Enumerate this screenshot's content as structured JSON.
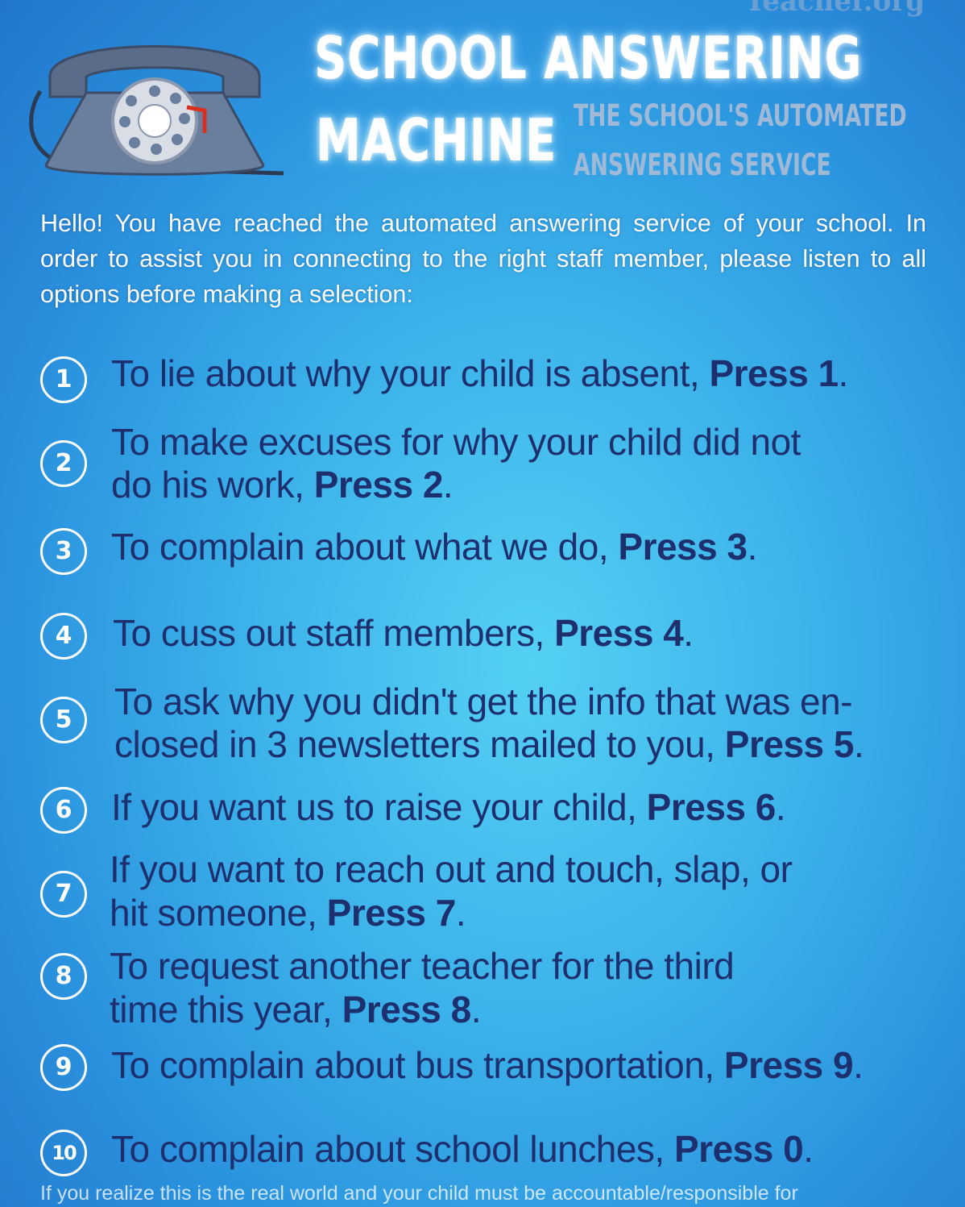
{
  "header": {
    "site": "Teacher.org",
    "title_line1": "SCHOOL ANSWERING",
    "title_line2": "MACHINE",
    "subtitle_line1": "THE SCHOOL'S AUTOMATED",
    "subtitle_line2": "ANSWERING SERVICE"
  },
  "phone_icon": "rotary-phone-icon",
  "intro": "Hello! You have reached the automated answering service of your school. In order to assist you in connecting to the right staff member, please listen to all options before making a selection:",
  "options": [
    {
      "num": "1",
      "line1": "To lie about why your child is absent, ",
      "line2": "",
      "press": "Press 1",
      "end": "."
    },
    {
      "num": "2",
      "line1": "To make excuses for why your child did not",
      "line2": "do his work, ",
      "press": "Press 2",
      "end": "."
    },
    {
      "num": "3",
      "line1": "To complain about what we do, ",
      "line2": "",
      "press": "Press 3",
      "end": "."
    },
    {
      "num": "4",
      "line1": "To cuss out staff members, ",
      "line2": "",
      "press": "Press 4",
      "end": "."
    },
    {
      "num": "5",
      "line1": "To ask why you didn't get the info that was en-",
      "line2": "closed in 3 newsletters mailed to you, ",
      "press": "Press 5",
      "end": "."
    },
    {
      "num": "6",
      "line1": "If you want us to raise your child, ",
      "line2": "",
      "press": "Press 6",
      "end": "."
    },
    {
      "num": "7",
      "line1": "If you want to reach out and touch, slap, or",
      "line2": "hit someone, ",
      "press": "Press 7",
      "end": "."
    },
    {
      "num": "8",
      "line1": "To request another teacher for the third",
      "line2": "time this year, ",
      "press": "Press 8",
      "end": "."
    },
    {
      "num": "9",
      "line1": "To complain about bus transportation, ",
      "line2": "",
      "press": "Press 9",
      "end": "."
    },
    {
      "num": "10",
      "line1": "To complain about school lunches, ",
      "line2": "",
      "press": "Press 0",
      "end": "."
    }
  ],
  "footer": "If you realize this is the real world and your child must be accountable/responsible for",
  "colors": {
    "background": "#3cb2ea",
    "option_text": "#1e2f6e",
    "title": "#ffffff",
    "subtitle": "#9fb9d6"
  }
}
